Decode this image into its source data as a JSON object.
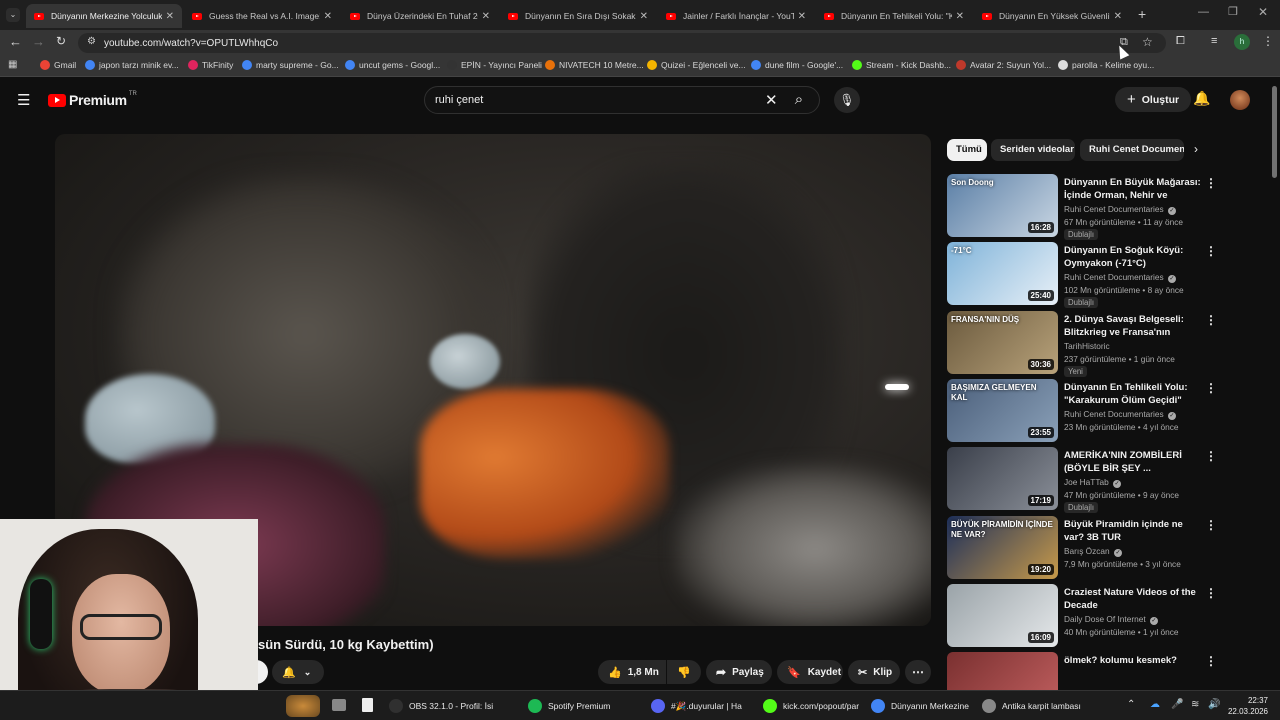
{
  "browser": {
    "tabs": [
      {
        "title": "Dünyanın Merkezine Yolculuk (Y",
        "active": true
      },
      {
        "title": "Guess the Real vs A.I. Image! - Y"
      },
      {
        "title": "Dünya Üzerindeki En Tuhaf 20"
      },
      {
        "title": "Dünyanın En Sıra Dışı Sokak Ye"
      },
      {
        "title": "Jainler / Farklı İnançlar - YouTu"
      },
      {
        "title": "Dünyanın En Tehlikeli Yolu: \"Ka"
      },
      {
        "title": "Dünyanın En Yüksek Güvenlikli"
      }
    ],
    "new_tab": "+",
    "url": "youtube.com/watch?v=OPUTLWhhqCo",
    "bookmarks": [
      {
        "label": "Gmail",
        "color": "#ea4335"
      },
      {
        "label": "japon tarzı minik ev...",
        "color": "#4285f4"
      },
      {
        "label": "TikFinity",
        "color": "#e0245e"
      },
      {
        "label": "marty supreme - Go...",
        "color": "#4285f4"
      },
      {
        "label": "uncut gems - Googl...",
        "color": "#4285f4"
      },
      {
        "label": "EPİN - Yayıncı Paneli",
        "color": "#333333"
      },
      {
        "label": "NIVATECH 10 Metre...",
        "color": "#e8710a"
      },
      {
        "label": "Quizei - Eğlenceli ve...",
        "color": "#f4b400"
      },
      {
        "label": "dune film - Google'...",
        "color": "#4285f4"
      },
      {
        "label": "Stream - Kick Dashb...",
        "color": "#53fc18"
      },
      {
        "label": "Avatar 2: Suyun Yol...",
        "color": "#c0392b"
      },
      {
        "label": "parolla - Kelime oyu...",
        "color": "#dddddd"
      }
    ],
    "profile_initial": "h"
  },
  "youtube": {
    "logo_text": "Premium",
    "logo_sup": "TR",
    "search_value": "ruhi çenet",
    "create_label": "Oluştur",
    "video_title": "sün Sürdü, 10 kg Kaybettim)",
    "like_count": "1,8 Mn",
    "share_label": "Paylaş",
    "save_label": "Kaydet",
    "clip_label": "Klip",
    "chips": [
      "Tümü",
      "Seriden videolar",
      "Ruhi Cenet Documentaries"
    ],
    "related": [
      {
        "title": "Dünyanın En Büyük Mağarası: İçinde Orman, Nehir ve Bulutla...",
        "channel": "Ruhi Cenet Documentaries",
        "verified": true,
        "meta": "67 Mn görüntüleme • 11 ay önce",
        "duration": "16:28",
        "badge": "Dublajlı",
        "thumb_text": "Son Doong",
        "colors": [
          "#5b7fa6",
          "#c9d6e3"
        ]
      },
      {
        "title": "Dünyanın En Soğuk Köyü: Oymyakon (-71°C)",
        "channel": "Ruhi Cenet Documentaries",
        "verified": true,
        "meta": "102 Mn görüntüleme • 8 ay önce",
        "duration": "25:40",
        "badge": "Dublajlı",
        "thumb_text": "-71°C",
        "colors": [
          "#7fb3d9",
          "#e8f0f7"
        ]
      },
      {
        "title": "2. Dünya Savaşı Belgeseli: Blitzkrieg ve Fransa'nın Düşüş...",
        "channel": "TarihHistoric",
        "verified": false,
        "meta": "237 görüntüleme • 1 gün önce",
        "duration": "30:36",
        "badge": "Yeni",
        "thumb_text": "FRANSA'NIN DÜŞ",
        "colors": [
          "#6b5a3e",
          "#b8a27a"
        ]
      },
      {
        "title": "Dünyanın En Tehlikeli Yolu: \"Karakurum Ölüm Geçidi\"",
        "channel": "Ruhi Cenet Documentaries",
        "verified": true,
        "meta": "23 Mn görüntüleme • 4 yıl önce",
        "duration": "23:55",
        "badge": "",
        "thumb_text": "BAŞIMIZA GELMEYEN KAL",
        "colors": [
          "#4a5e7a",
          "#8aa0b8"
        ]
      },
      {
        "title": "AMERİKA'NIN ZOMBİLERİ (BÖYLE BİR ŞEY ...",
        "channel": "Joe HaTTab",
        "verified": true,
        "meta": "47 Mn görüntüleme • 9 ay önce",
        "duration": "17:19",
        "badge": "Dublajlı",
        "thumb_text": "",
        "colors": [
          "#3a3f4a",
          "#8a8f98"
        ]
      },
      {
        "title": "Büyük Piramidin içinde ne var? 3B TUR",
        "channel": "Barış Özcan",
        "verified": true,
        "meta": "7,9 Mn görüntüleme • 3 yıl önce",
        "duration": "19:20",
        "badge": "",
        "thumb_text": "BÜYÜK PİRAMİDİN İÇİNDE NE VAR?",
        "colors": [
          "#1d2f5a",
          "#c79a4a"
        ]
      },
      {
        "title": "Craziest Nature Videos of the Decade",
        "channel": "Daily Dose Of Internet",
        "verified": true,
        "meta": "40 Mn görüntüleme • 1 yıl önce",
        "duration": "16:09",
        "badge": "",
        "thumb_text": "",
        "colors": [
          "#9aa3a8",
          "#e5e8ea"
        ]
      },
      {
        "title": "ölmek? kolumu kesmek?",
        "channel": "",
        "verified": false,
        "meta": "",
        "duration": "",
        "badge": "",
        "thumb_text": "",
        "colors": [
          "#7a3030",
          "#c26060"
        ]
      }
    ]
  },
  "taskbar": {
    "items": [
      {
        "label": "OBS 32.1.0 - Profil: İsi",
        "color": "#303030"
      },
      {
        "label": "Spotify Premium",
        "color": "#1db954"
      },
      {
        "label": "#🎉.duyurular | Ha",
        "color": "#5865f2"
      },
      {
        "label": "kick.com/popout/par",
        "color": "#53fc18"
      },
      {
        "label": "Dünyanın Merkezine",
        "color": "#4285f4"
      },
      {
        "label": "Antika karpit lambası",
        "color": "#888888"
      }
    ],
    "time": "22:37",
    "date": "22.03.2026"
  }
}
